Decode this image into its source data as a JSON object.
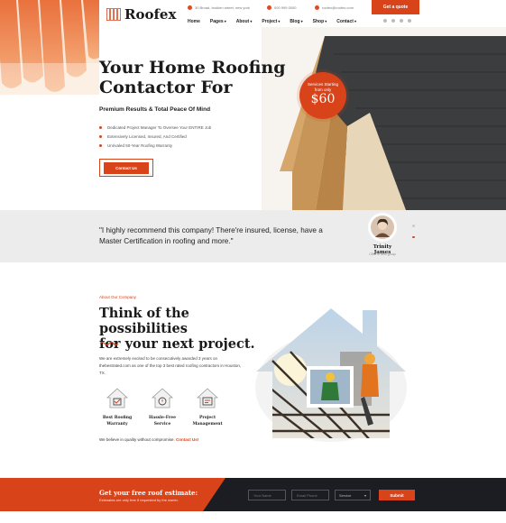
{
  "brand": {
    "name": "Roofex",
    "accent": "#d9431a",
    "dark": "#1c1d22"
  },
  "topbar": {
    "address": "30 Broad, broklen street, new york",
    "phone": "000 999 0000",
    "email": "roofex@roofex.com",
    "quote_button": "Get a quote"
  },
  "nav": {
    "items": [
      "Home",
      "Pages",
      "About",
      "Project",
      "Blog",
      "Shop",
      "Contact"
    ],
    "social_icons": [
      "facebook-icon",
      "twitter-icon",
      "pinterest-icon",
      "linkedin-icon"
    ]
  },
  "hero": {
    "title_line1": "Your Home Roofing",
    "title_line2": "Contactor For",
    "subtitle": "Premium Results & Total Peace Of Mind",
    "bullets": [
      "Dedicated Project Manager To Oversee Your ENTIRE Job",
      "Extensively Licensed, Insured, And Certified",
      "Unrivaled 50-Year Roofing Warranty"
    ],
    "cta": "Contact Us",
    "badge": {
      "line1": "Services Starting",
      "line2": "from only",
      "price": "$60"
    }
  },
  "testimonial": {
    "quote": "\"I highly recommend this company! There're insured, license, have a Master Certification in roofing and more.\"",
    "author": "Trinity James",
    "role": "CEO of dom group"
  },
  "about": {
    "eyebrow": "About Our Company",
    "title_line1": "Think of the possibilities",
    "title_line2": "for your next project.",
    "paragraph": "We are extremely excited to be consecutively awarded 3 years on thebestrated.com as one of the top 3 best rated roofing contractors in Houston, TX.",
    "features": [
      {
        "icon": "roofing-warranty-icon",
        "line1": "Best Roofing",
        "line2": "Warranty"
      },
      {
        "icon": "hassle-free-icon",
        "line1": "Hassle-Free",
        "line2": "Service"
      },
      {
        "icon": "project-management-icon",
        "line1": "Project",
        "line2": "Management"
      }
    ],
    "believe_text": "We believe in quality without compromise.",
    "believe_link": "Contact Us!"
  },
  "estimate": {
    "title": "Get your free roof estimate:",
    "subtitle": "Estimates are only free if requested by the owner.",
    "name_placeholder": "Your Name",
    "email_placeholder": "Email Phone",
    "service_label": "Service",
    "submit": "Submit"
  }
}
